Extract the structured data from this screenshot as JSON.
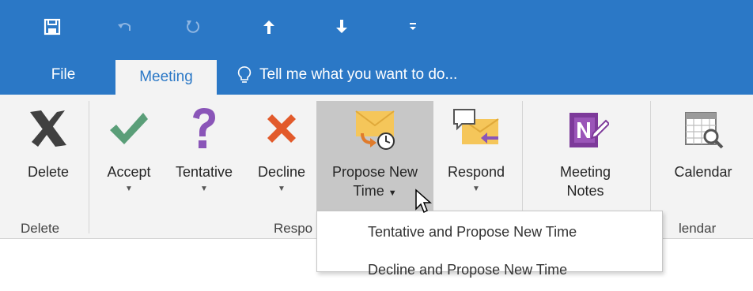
{
  "tabs": [
    {
      "label": "File"
    },
    {
      "label": "Meeting"
    }
  ],
  "tell_me": "Tell me what you want to do...",
  "ribbon": {
    "buttons": {
      "delete": "Delete",
      "accept": "Accept",
      "tentative": "Tentative",
      "decline": "Decline",
      "propose_line1": "Propose New",
      "propose_line2": "Time",
      "respond": "Respond",
      "notes_line1": "Meeting",
      "notes_line2": "Notes",
      "calendar": "Calendar"
    },
    "groups": {
      "delete": "Delete",
      "respond": "Respo",
      "calendar": "lendar"
    }
  },
  "menu": {
    "items": [
      {
        "label": "Tentative and Propose New Time"
      },
      {
        "label": "Decline and Propose New Time"
      }
    ]
  },
  "colors": {
    "brand": "#2b78c6",
    "ribbon_bg": "#f3f3f3",
    "accept_green": "#5a9e78",
    "tentative_purple": "#8a55b8",
    "decline_orange": "#e25a2b"
  },
  "icons": [
    "save-icon",
    "undo-icon",
    "redo-icon",
    "up-arrow-icon",
    "down-arrow-icon",
    "customize-icon",
    "lightbulb-icon",
    "delete-x-icon",
    "checkmark-icon",
    "question-icon",
    "decline-x-icon",
    "propose-time-icon",
    "respond-icon",
    "onenote-icon",
    "calendar-icon",
    "cursor-icon"
  ]
}
